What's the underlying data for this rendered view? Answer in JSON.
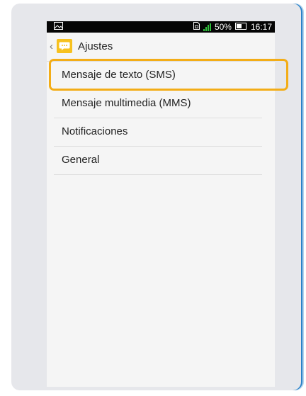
{
  "status_bar": {
    "battery_percent": "50%",
    "time": "16:17",
    "icons": [
      "image-icon",
      "sim-icon",
      "signal-icon",
      "battery-icon"
    ],
    "signal_color": "#2fbf3a"
  },
  "action_bar": {
    "title": "Ajustes",
    "icons": [
      "back-arrow-icon",
      "messages-app-icon"
    ],
    "app_icon_color": "#f7c11e"
  },
  "settings_list": {
    "items": [
      {
        "label": "Mensaje de texto (SMS)"
      },
      {
        "label": "Mensaje multimedia (MMS)"
      },
      {
        "label": "Notificaciones"
      },
      {
        "label": "General"
      }
    ]
  },
  "highlight": {
    "color": "#f3ad17",
    "target": "Mensaje de texto (SMS)"
  }
}
